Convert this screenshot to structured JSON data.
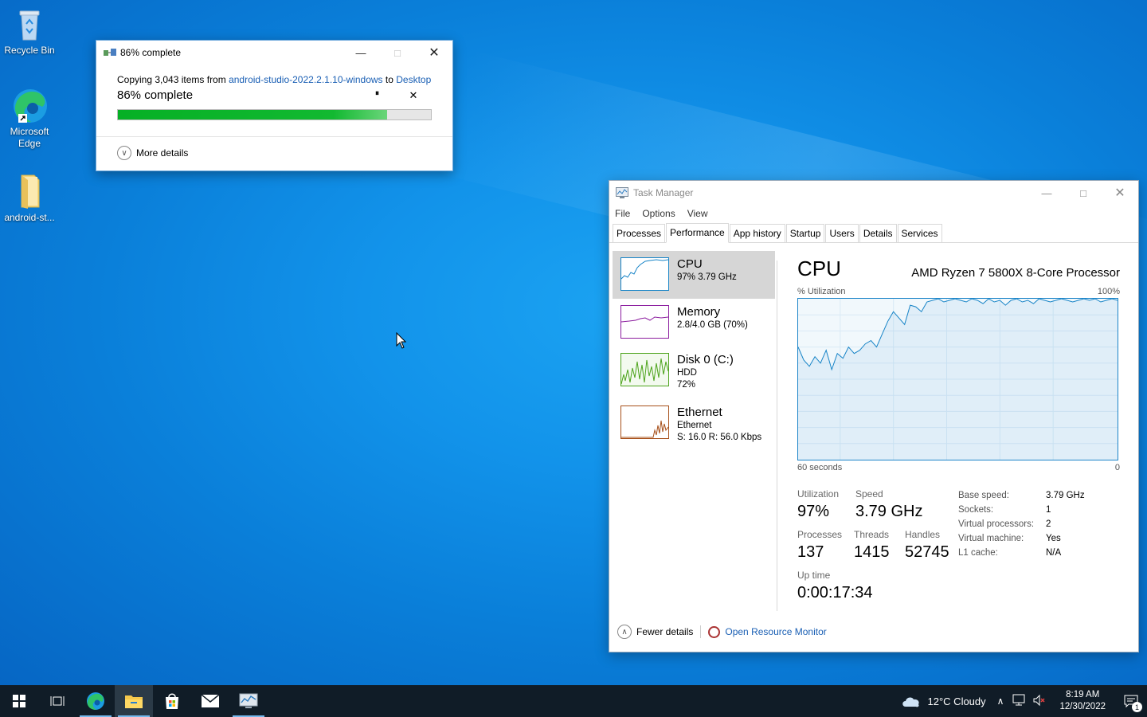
{
  "desktop": {
    "icons": [
      {
        "label": "Recycle Bin"
      },
      {
        "label": "Microsoft Edge"
      },
      {
        "label": "android-st..."
      }
    ]
  },
  "copy_dialog": {
    "title": "86% complete",
    "copying_prefix": "Copying 3,043 items from",
    "source": "android-studio-2022.2.1.10-windows",
    "to_word": "to",
    "destination": "Desktop",
    "status": "86% complete",
    "progress_percent": 86,
    "more_details": "More details",
    "pause_glyph": "⏸",
    "cancel_glyph": "✕"
  },
  "task_manager": {
    "title": "Task Manager",
    "menu": [
      "File",
      "Options",
      "View"
    ],
    "tabs": [
      "Processes",
      "Performance",
      "App history",
      "Startup",
      "Users",
      "Details",
      "Services"
    ],
    "active_tab": "Performance",
    "resources": [
      {
        "name": "CPU",
        "line1": "97%  3.79 GHz",
        "line2": "",
        "line3": "",
        "color": "#1784c7"
      },
      {
        "name": "Memory",
        "line1": "2.8/4.0 GB (70%)",
        "line2": "",
        "line3": "",
        "color": "#8b1c9e"
      },
      {
        "name": "Disk 0 (C:)",
        "line1": "HDD",
        "line2": "72%",
        "line3": "",
        "color": "#4da41c"
      },
      {
        "name": "Ethernet",
        "line1": "Ethernet",
        "line2": "S: 16.0  R: 56.0 Kbps",
        "line3": "",
        "color": "#a7501a"
      }
    ],
    "cpu": {
      "heading": "CPU",
      "model": "AMD Ryzen 7 5800X 8-Core Processor",
      "util_label": "% Utilization",
      "util_max": "100%",
      "time_label": "60 seconds",
      "time_min": "0",
      "graph_values": [
        70,
        62,
        58,
        64,
        60,
        68,
        56,
        66,
        63,
        70,
        66,
        68,
        72,
        74,
        70,
        78,
        86,
        92,
        88,
        84,
        96,
        95,
        92,
        98,
        99,
        100,
        98,
        99,
        100,
        99,
        98,
        100,
        99,
        97,
        100,
        98,
        99,
        96,
        99,
        100,
        98,
        99,
        97,
        100,
        99,
        98,
        99,
        100,
        99,
        98,
        99,
        100,
        99,
        100,
        98,
        99,
        100,
        99
      ],
      "utilization_label": "Utilization",
      "utilization": "97%",
      "speed_label": "Speed",
      "speed": "3.79 GHz",
      "processes_label": "Processes",
      "processes": "137",
      "threads_label": "Threads",
      "threads": "1415",
      "handles_label": "Handles",
      "handles": "52745",
      "uptime_label": "Up time",
      "uptime": "0:00:17:34",
      "details": [
        {
          "k": "Base speed:",
          "v": "3.79 GHz"
        },
        {
          "k": "Sockets:",
          "v": "1"
        },
        {
          "k": "Virtual processors:",
          "v": "2"
        },
        {
          "k": "Virtual machine:",
          "v": "Yes"
        },
        {
          "k": "L1 cache:",
          "v": "N/A"
        }
      ]
    },
    "footer": {
      "fewer_details": "Fewer details",
      "open_resource_monitor": "Open Resource Monitor"
    }
  },
  "taskbar": {
    "weather": "12°C  Cloudy",
    "time": "8:19 AM",
    "date": "12/30/2022",
    "notification_count": "1"
  },
  "colors": {
    "accent": "#1784c7",
    "progress": "#06b025",
    "taskbar": "#101c27"
  }
}
